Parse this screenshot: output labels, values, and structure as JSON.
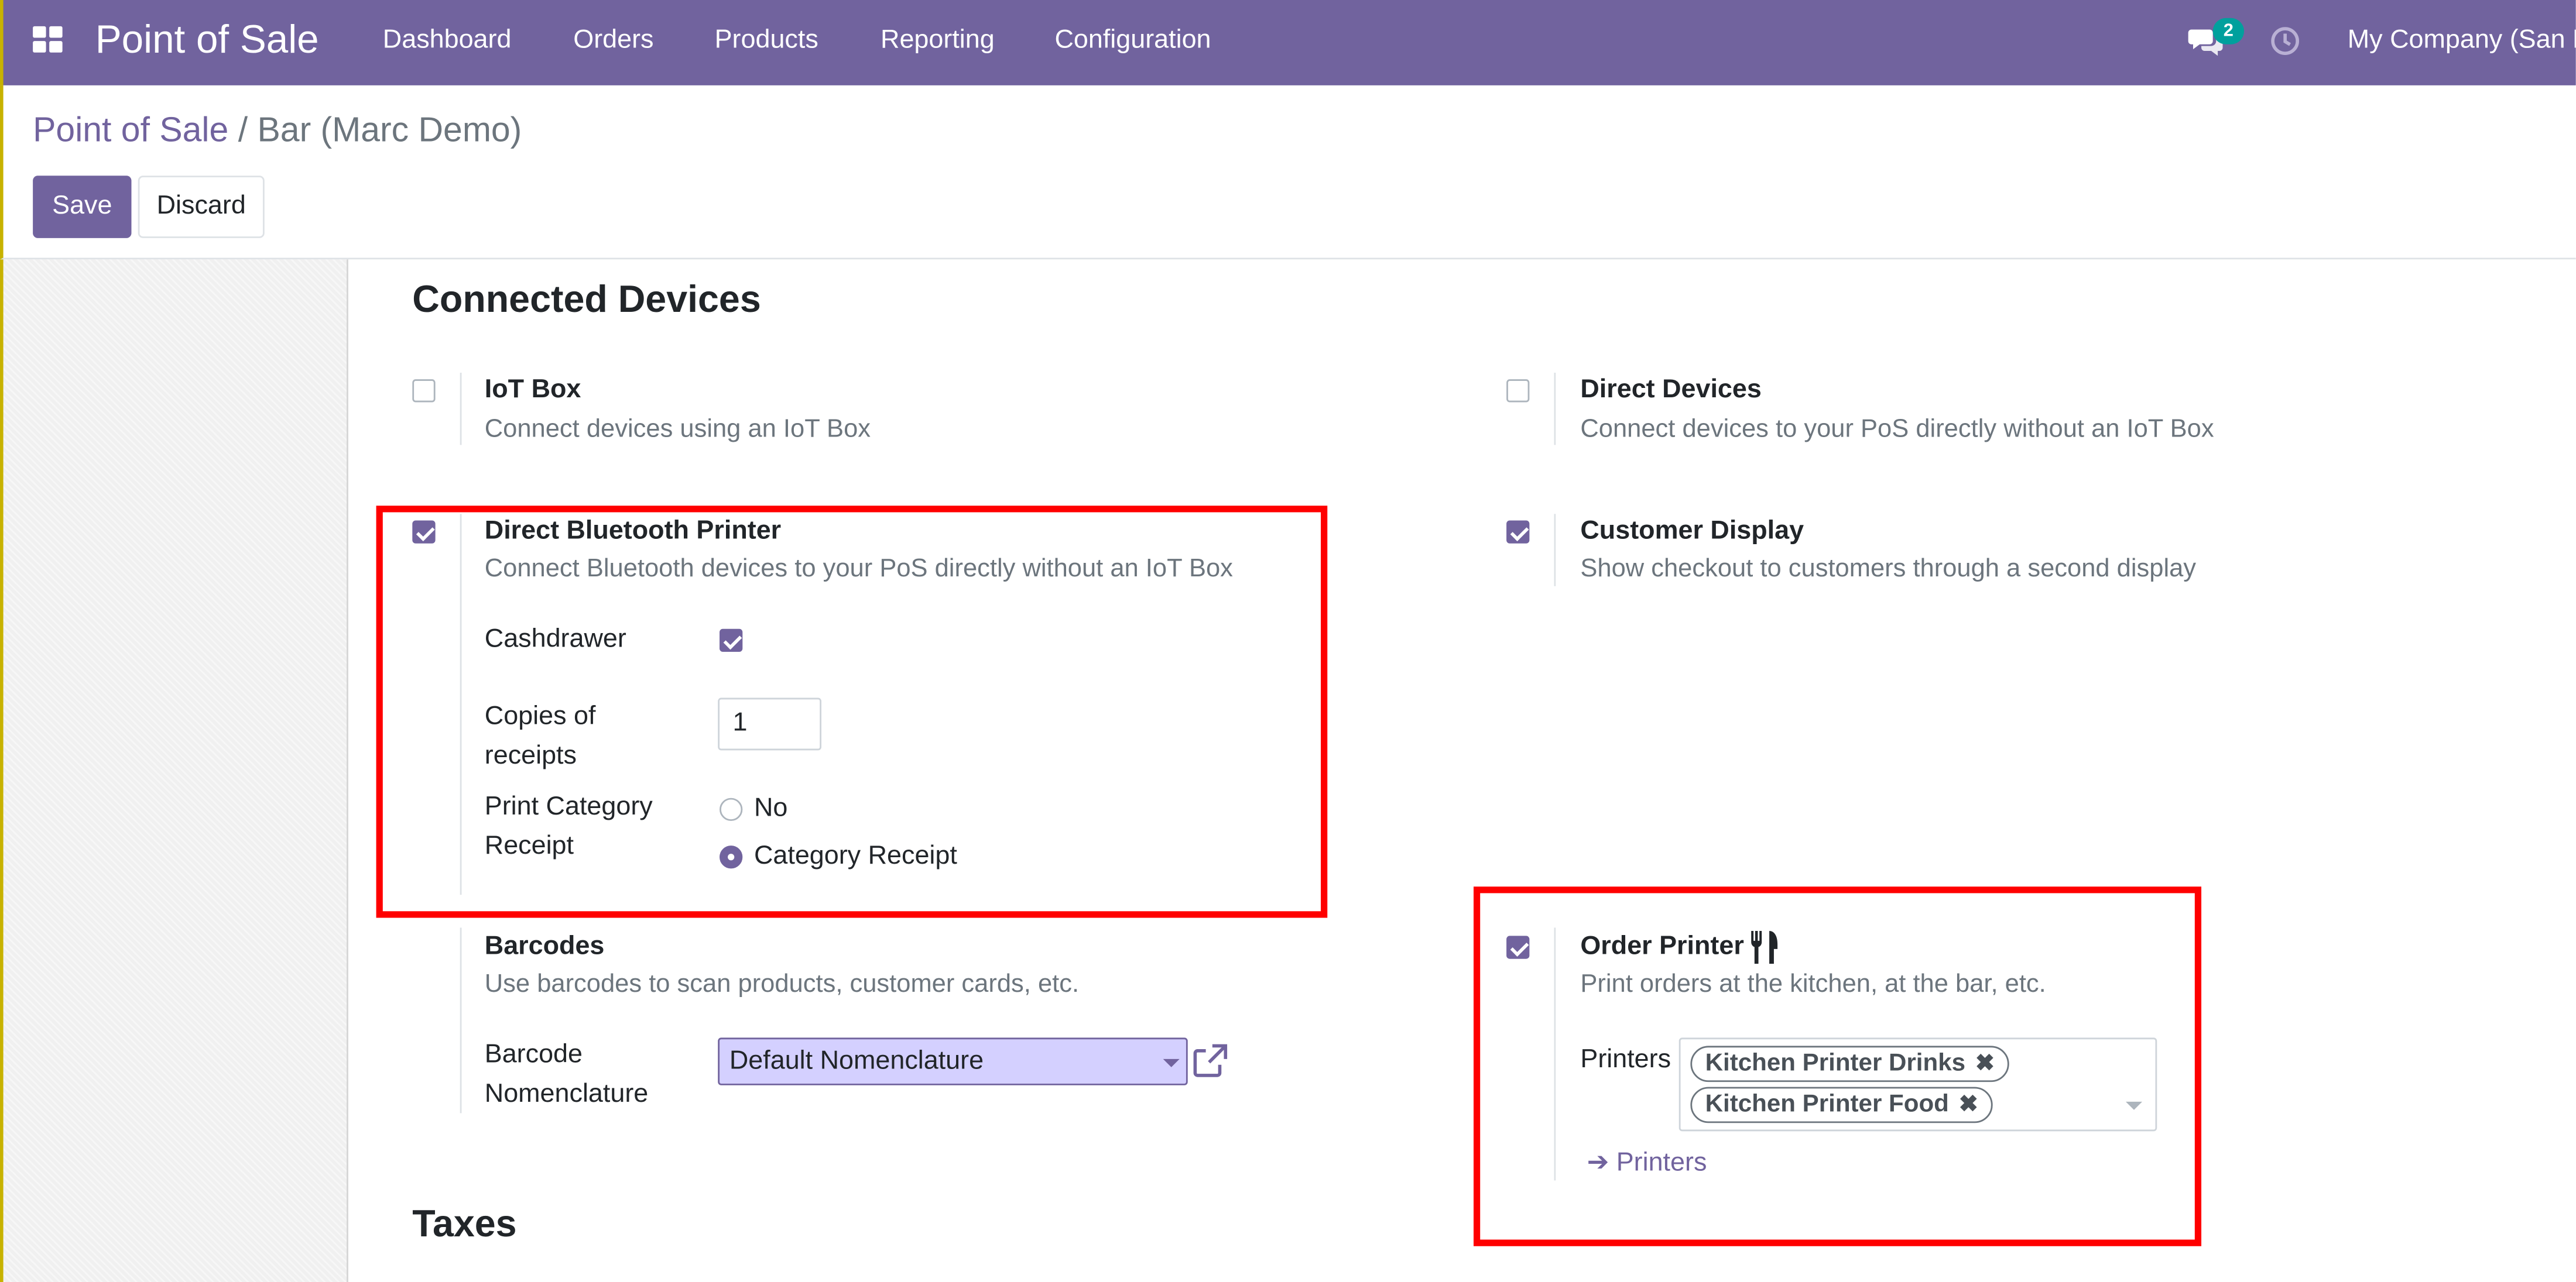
{
  "navbar": {
    "app_name": "Point of Sale",
    "menu": [
      "Dashboard",
      "Orders",
      "Products",
      "Reporting",
      "Configuration"
    ],
    "messages_count": "2",
    "company": "My Company (San F",
    "bg_color": "#71639e"
  },
  "breadcrumb": {
    "parent": "Point of Sale",
    "separator": "/",
    "current": "Bar (Marc Demo)"
  },
  "actions": {
    "save_label": "Save",
    "discard_label": "Discard"
  },
  "connected_devices": {
    "heading": "Connected Devices",
    "iot_box": {
      "title": "IoT Box",
      "help": "Connect devices using an IoT Box",
      "checked": false
    },
    "direct_devices": {
      "title": "Direct Devices",
      "help": "Connect devices to your PoS directly without an IoT Box",
      "checked": false
    },
    "bluetooth_printer": {
      "title": "Direct Bluetooth Printer",
      "help": "Connect Bluetooth devices to your PoS directly without an IoT Box",
      "checked": true,
      "cashdrawer_label": "Cashdrawer",
      "cashdrawer_checked": true,
      "copies_label": "Copies of receipts",
      "copies_value": "1",
      "print_category_label": "Print Category Receipt",
      "options": [
        "No",
        "Category Receipt"
      ],
      "selected_option": "Category Receipt"
    },
    "customer_display": {
      "title": "Customer Display",
      "help": "Show checkout to customers through a second display",
      "checked": true
    },
    "barcodes": {
      "title": "Barcodes",
      "help": "Use barcodes to scan products, customer cards, etc.",
      "nomenclature_label": "Barcode Nomenclature",
      "nomenclature_value": "Default Nomenclature"
    },
    "order_printer": {
      "title": "Order Printer",
      "help": "Print orders at the kitchen, at the bar, etc.",
      "checked": true,
      "printers_label": "Printers",
      "printers": [
        "Kitchen Printer Drinks",
        "Kitchen Printer Food"
      ],
      "printers_link": "Printers",
      "icon": "utensils-icon"
    }
  },
  "taxes": {
    "heading": "Taxes"
  },
  "colors": {
    "accent": "#71639e",
    "highlight_box": "#ff0000",
    "select_bg": "#d4d0ff"
  }
}
